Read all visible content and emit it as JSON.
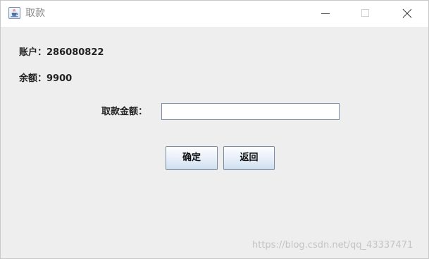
{
  "window": {
    "title": "取款",
    "icon": "java-cup-icon"
  },
  "account": {
    "label": "账户：",
    "value": "286080822"
  },
  "balance": {
    "label": "余额：",
    "value": "9900"
  },
  "withdraw": {
    "label": "取款金额：",
    "value": "",
    "placeholder": ""
  },
  "buttons": {
    "confirm": "确定",
    "back": "返回"
  },
  "watermark": "https://blog.csdn.net/qq_43337471",
  "colors": {
    "background": "#eeeeee",
    "titlebar": "#ffffff",
    "input_border": "#7a8ea8"
  }
}
